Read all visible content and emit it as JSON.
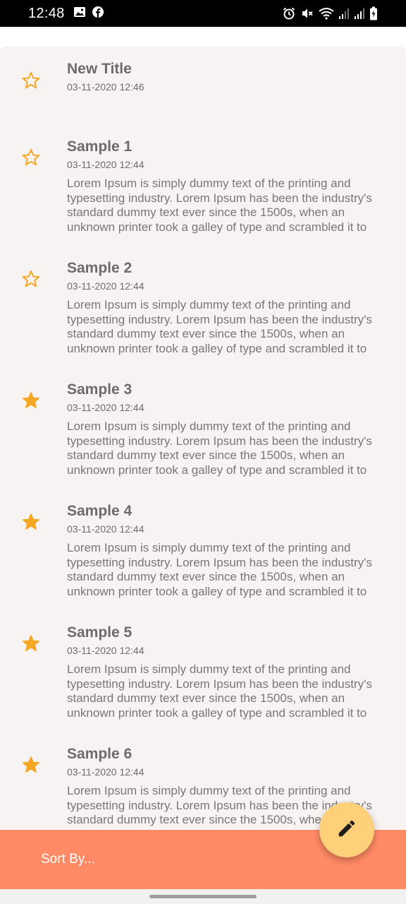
{
  "status_bar": {
    "time": "12:48",
    "left_icons": [
      "image-icon",
      "facebook-icon"
    ],
    "right_icons": [
      "alarm-icon",
      "mute-icon",
      "wifi-icon",
      "signal-icon",
      "signal-icon",
      "battery-icon"
    ]
  },
  "notes": [
    {
      "title": "New Title",
      "date": "03-11-2020 12:46",
      "body": "",
      "starred": false
    },
    {
      "title": "Sample 1",
      "date": "03-11-2020 12:44",
      "body": "Lorem Ipsum is simply dummy text of the printing and typesetting industry. Lorem Ipsum has been the industry's standard dummy text ever since the 1500s, when an unknown printer took a galley of type and scrambled it to",
      "starred": false
    },
    {
      "title": "Sample 2",
      "date": "03-11-2020 12:44",
      "body": "Lorem Ipsum is simply dummy text of the printing and typesetting industry. Lorem Ipsum has been the industry's standard dummy text ever since the 1500s, when an unknown printer took a galley of type and scrambled it to",
      "starred": false
    },
    {
      "title": "Sample 3",
      "date": "03-11-2020 12:44",
      "body": "Lorem Ipsum is simply dummy text of the printing and typesetting industry. Lorem Ipsum has been the industry's standard dummy text ever since the 1500s, when an unknown printer took a galley of type and scrambled it to",
      "starred": true
    },
    {
      "title": "Sample 4",
      "date": "03-11-2020 12:44",
      "body": "Lorem Ipsum is simply dummy text of the printing and typesetting industry. Lorem Ipsum has been the industry's standard dummy text ever since the 1500s, when an unknown printer took a galley of type and scrambled it to",
      "starred": true
    },
    {
      "title": "Sample 5",
      "date": "03-11-2020 12:44",
      "body": "Lorem Ipsum is simply dummy text of the printing and typesetting industry. Lorem Ipsum has been the industry's standard dummy text ever since the 1500s, when an unknown printer took a galley of type and scrambled it to",
      "starred": true
    },
    {
      "title": "Sample 6",
      "date": "03-11-2020 12:44",
      "body": "Lorem Ipsum is simply dummy text of the printing and typesetting industry. Lorem Ipsum has been the industry's standard dummy text ever since the 1500s, when an unknown printer took a galley of type and scrambled it to",
      "starred": true
    }
  ],
  "bottom_bar": {
    "sort_label": "Sort By...",
    "fab_icon": "pencil-icon"
  },
  "colors": {
    "accent_star": "#f5a623",
    "bottom_bar": "#ff8a65",
    "fab": "#ffd07a",
    "card_bg": "#f7f3f2"
  }
}
